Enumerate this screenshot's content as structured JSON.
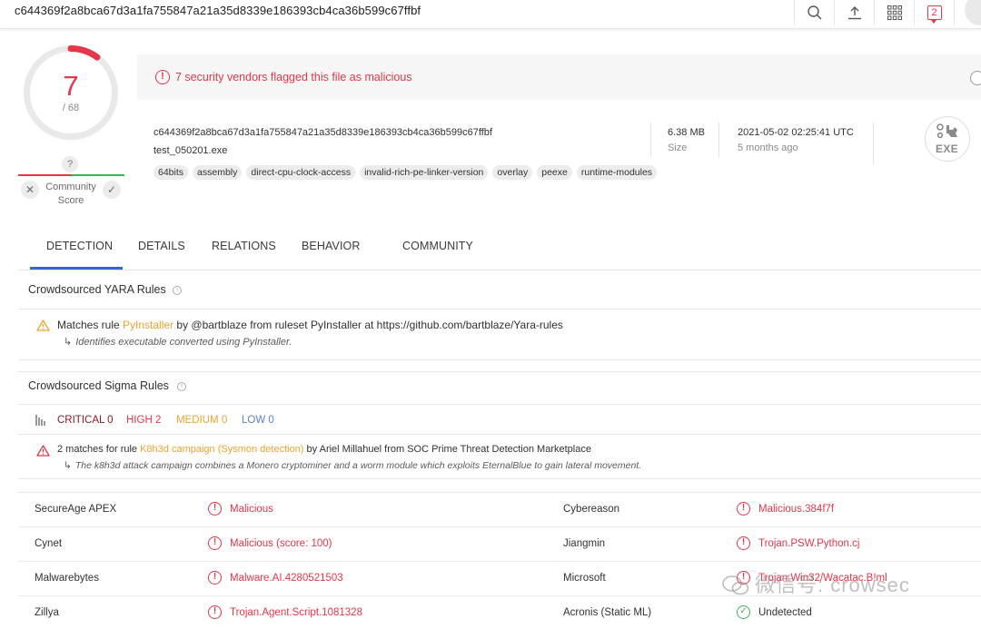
{
  "topbar": {
    "search_value": "c644369f2a8bca67d3a1fa755847a21a35d8339e186393cb4ca36b599c67ffbf",
    "notification_count": "2"
  },
  "score": {
    "detections": "7",
    "total": "/ 68",
    "community_unknown": "?",
    "community_label": "Community Score",
    "colors": {
      "malicious": "#e5364a",
      "clean": "#3bb25c"
    }
  },
  "alert": {
    "icon": "!",
    "text": "7 security vendors flagged this file as malicious"
  },
  "file": {
    "hash": "c644369f2a8bca67d3a1fa755847a21a35d8339e186393cb4ca36b599c67ffbf",
    "name": "test_050201.exe",
    "size_value": "6.38 MB",
    "size_label": "Size",
    "date_value": "2021-05-02 02:25:41 UTC",
    "date_label": "5 months ago",
    "type_badge": "EXE",
    "tags": [
      "64bits",
      "assembly",
      "direct-cpu-clock-access",
      "invalid-rich-pe-linker-version",
      "overlay",
      "peexe",
      "runtime-modules"
    ]
  },
  "tabs": [
    "DETECTION",
    "DETAILS",
    "RELATIONS",
    "BEHAVIOR",
    "COMMUNITY"
  ],
  "yara": {
    "title": "Crowdsourced YARA Rules",
    "match_prefix": "Matches rule ",
    "rule_name": "PyInstaller",
    "match_suffix": " by @bartblaze from ruleset PyInstaller at https://github.com/bartblaze/Yara-rules",
    "description": "Identifies executable converted using PyInstaller."
  },
  "sigma": {
    "title": "Crowdsourced Sigma Rules",
    "critical": "CRITICAL 0",
    "high": "HIGH 2",
    "medium": "MEDIUM 0",
    "low": "LOW 0",
    "match_prefix": "2 matches for rule ",
    "rule_name": "K8h3d campaign (Sysmon detection)",
    "match_suffix": " by Ariel Millahuel from SOC Prime Threat Detection Marketplace",
    "description": "The k8h3d attack campaign combines a Monero cryptominer and a worm module which exploits EternalBlue to gain lateral movement.",
    "colors": {
      "critical": "#8b1a2b",
      "high": "#e5364a",
      "medium": "#f0a22e",
      "low": "#5b7fd6"
    }
  },
  "detections": [
    {
      "vendor": "SecureAge APEX",
      "result": "Malicious",
      "vendor2": "Cybereason",
      "result2": "Malicious.384f7f"
    },
    {
      "vendor": "Cynet",
      "result": "Malicious (score: 100)",
      "vendor2": "Jiangmin",
      "result2": "Trojan.PSW.Python.cj"
    },
    {
      "vendor": "Malwarebytes",
      "result": "Malware.AI.4280521503",
      "vendor2": "Microsoft",
      "result2": "Trojan:Win32/Wacatac.B!ml"
    },
    {
      "vendor": "Zillya",
      "result": "Trojan.Agent.Script.1081328",
      "vendor2": "Acronis (Static ML)",
      "result2": "Undetected"
    }
  ],
  "watermark": "微信号: crowsec"
}
